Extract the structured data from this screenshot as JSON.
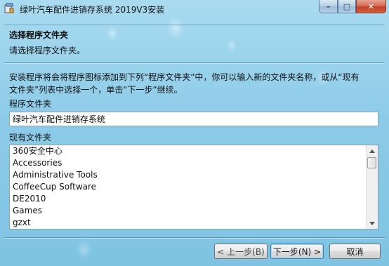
{
  "window": {
    "title": "绿叶汽车配件进销存系统 2019V3安装",
    "controls": {
      "minimize": "–",
      "maximize": "□",
      "close": "✕"
    }
  },
  "header": {
    "heading": "选择程序文件夹",
    "subheading": "请选择程序文件夹。"
  },
  "description": {
    "line1": "安装程序将会将程序图标添加到下列“程序文件夹”中，你可以输入新的文件夹名称，或从“现有",
    "line2": "文件夹”列表中选择一个，单击“下一步”继续。"
  },
  "program_folder": {
    "label": "程序文件夹",
    "value": "绿叶汽车配件进销存系统"
  },
  "existing_folders": {
    "label": "现有文件夹",
    "items": [
      "360安全中心",
      "Accessories",
      "Administrative Tools",
      "CoffeeCup Software",
      "DE2010",
      "Games",
      "gzxt"
    ]
  },
  "buttons": {
    "back": "< 上一步(B)",
    "next": "下一步(N) >",
    "cancel": "取消"
  },
  "icons": {
    "app": "installer-icon",
    "scroll_up": "scroll-up-arrow-icon",
    "scroll_down": "scroll-down-arrow-icon"
  }
}
